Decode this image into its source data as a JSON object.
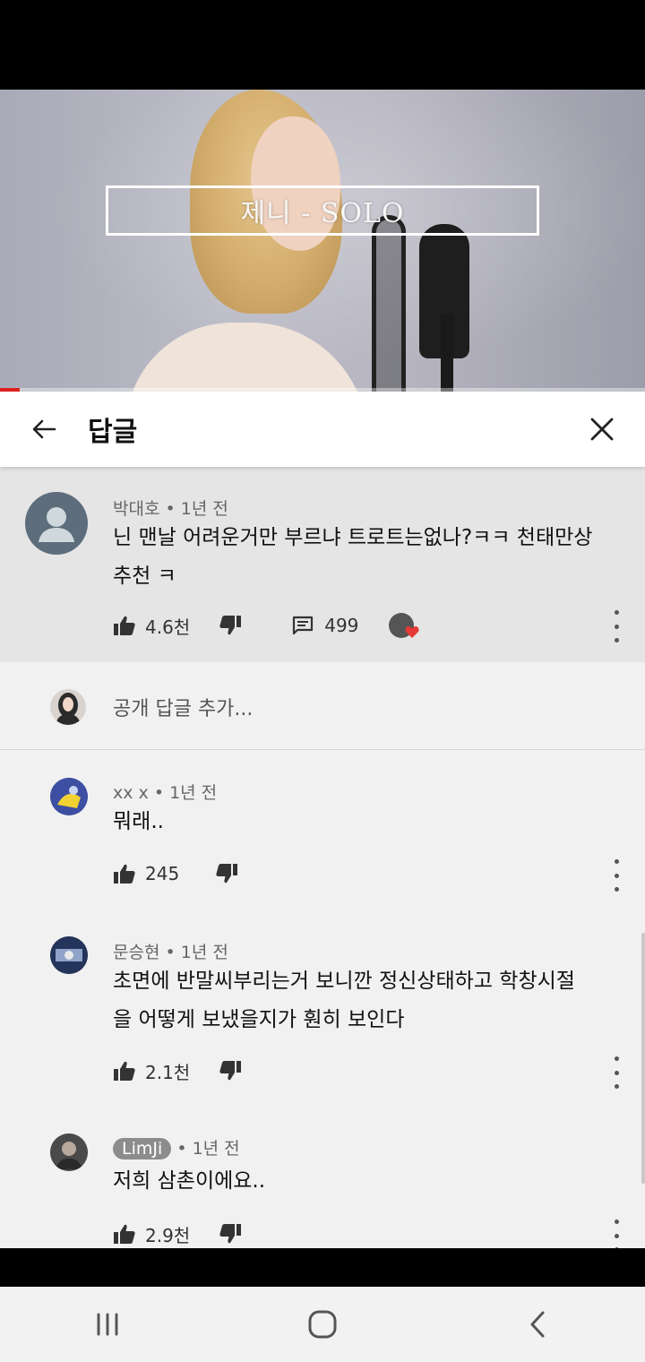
{
  "video": {
    "title_overlay": "제니 - SOLO",
    "progress": 0.03
  },
  "panel": {
    "title": "답글",
    "back_icon": "arrow-left-icon",
    "close_icon": "close-icon"
  },
  "parent_comment": {
    "author": "박대호",
    "time": "1년 전",
    "text_line1": "닌 맨날 어려운거만 부르냐 트로트는없나?ㅋㅋ 천태만상",
    "text_line2": "추천 ㅋ",
    "likes": "4.6천",
    "replies": "499"
  },
  "add_reply": {
    "placeholder": "공개 답글 추가..."
  },
  "replies": [
    {
      "author": "xx x",
      "time": "1년 전",
      "lines": [
        "뭐래.."
      ],
      "likes": "245"
    },
    {
      "author": "문승현",
      "time": "1년 전",
      "lines": [
        "초면에 반말씨부리는거 보니깐 정신상태하고 학창시절",
        "을 어떻게 보냈을지가 훤히 보인다"
      ],
      "likes": "2.1천"
    },
    {
      "author": "LimJi",
      "time": "1년 전",
      "lines": [
        "저희 삼촌이에요.."
      ],
      "likes": "2.9천",
      "author_highlighted": true
    }
  ],
  "colors": {
    "accent_red": "#e02020",
    "heart_red": "#e53935",
    "meta_gray": "#666666"
  }
}
